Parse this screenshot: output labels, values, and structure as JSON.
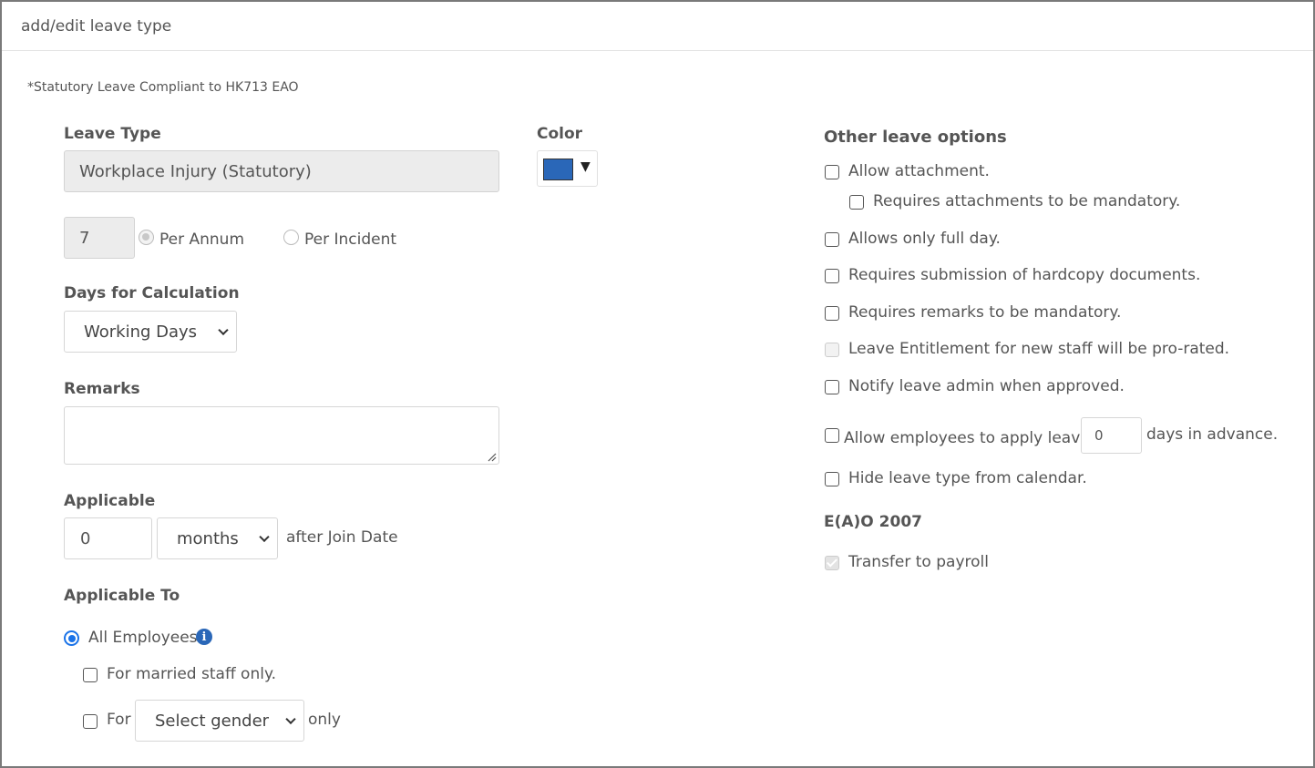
{
  "header": {
    "title": "add/edit leave type"
  },
  "note": "*Statutory Leave Compliant to HK713 EAO",
  "leave_type": {
    "label": "Leave Type",
    "value": "Workplace Injury (Statutory)"
  },
  "color": {
    "label": "Color",
    "swatch": "#2a67b8",
    "caret": "▼"
  },
  "entitlement": {
    "days": "7",
    "per_annum_label": "Per Annum",
    "per_incident_label": "Per Incident",
    "selected": "per_annum"
  },
  "days_for_calculation": {
    "label": "Days for Calculation",
    "selected": "Working Days"
  },
  "remarks": {
    "label": "Remarks",
    "value": ""
  },
  "applicable": {
    "label": "Applicable",
    "value": "0",
    "unit": "months",
    "suffix": "after Join Date"
  },
  "applicable_to": {
    "label": "Applicable To",
    "all_employees": "All Employees",
    "married_only": "For married staff only.",
    "for_label": "For",
    "gender_placeholder": "Select gender",
    "only_label": "only"
  },
  "other_options": {
    "title": "Other leave options",
    "allow_attachment": "Allow attachment.",
    "attachments_mandatory": "Requires attachments to be mandatory.",
    "full_day_only": "Allows only full day.",
    "hardcopy_docs": "Requires submission of hardcopy documents.",
    "remarks_mandatory": "Requires remarks to be mandatory.",
    "pro_rated": "Leave Entitlement for new staff will be pro-rated.",
    "notify_admin": "Notify leave admin when approved.",
    "apply_in_advance_label": "Allow employees to apply leave",
    "advance_days": "0",
    "advance_suffix": "days in advance.",
    "hide_from_calendar": "Hide leave type from calendar."
  },
  "eao": {
    "title": "E(A)O 2007",
    "transfer_payroll": "Transfer to payroll"
  },
  "colors": {
    "accent": "#1a73e8",
    "info": "#2a67b8"
  }
}
